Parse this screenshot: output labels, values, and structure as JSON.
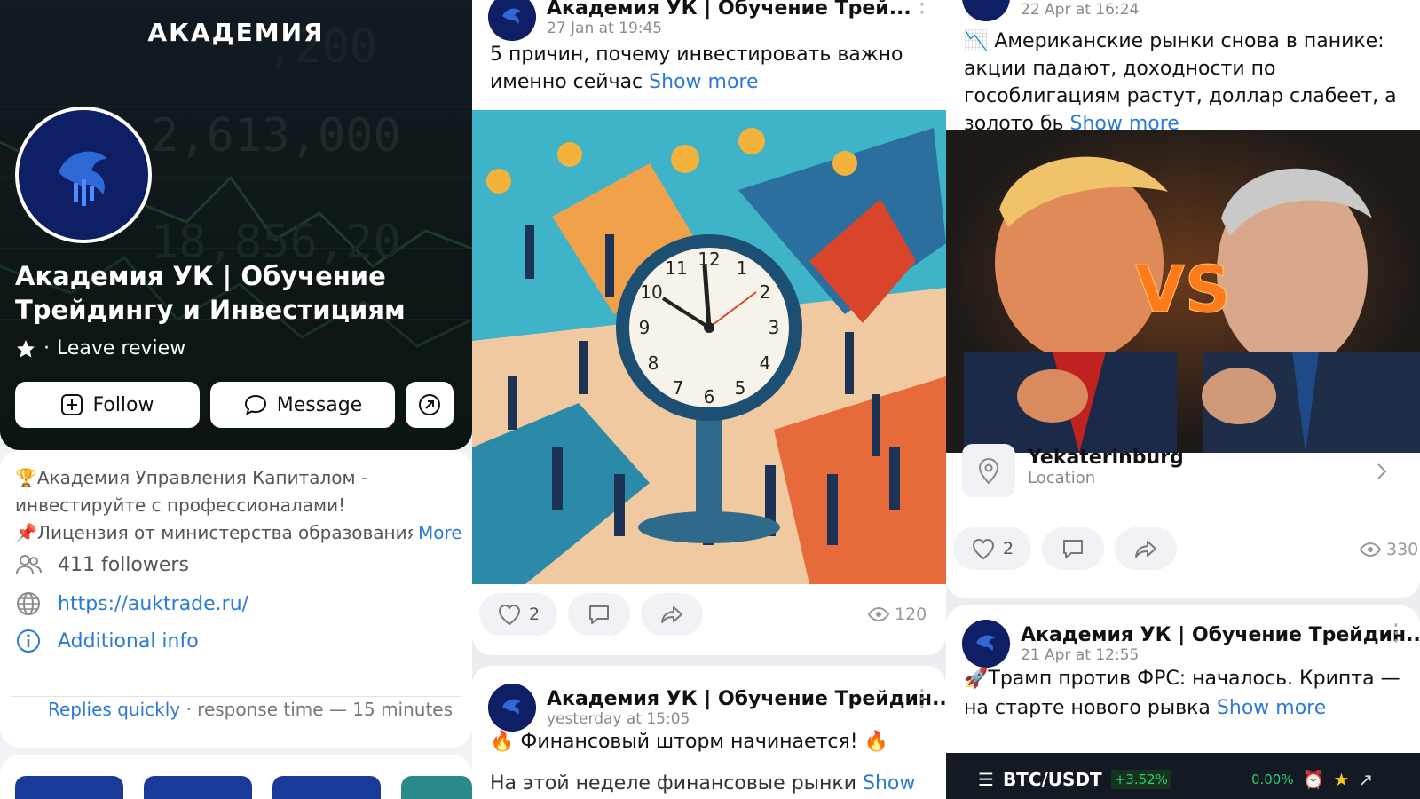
{
  "channel": {
    "brand": "АКАДЕМИЯ",
    "title": "Академия УК | Обучение Трейдингу и Инвестициям",
    "leave_review": "Leave review",
    "follow": "Follow",
    "message": "Message",
    "description": "🏆Академия Управления Капиталом - инвестируйте с профессионалами!\n📌Лицензия от министерства образования",
    "more": "More",
    "followers": "411 followers",
    "url": "https://auktrade.ru/",
    "additional": "Additional info",
    "replies_quickly": "Replies quickly",
    "response_time": " · response time — 15 minutes"
  },
  "posts": [
    {
      "name": "Академия УК | Обучение Трей...",
      "date": "27 Jan at 19:45",
      "text": "5 причин, почему инвестировать важно именно сейчас",
      "show_more": "Show more",
      "likes": "2",
      "views": "120"
    },
    {
      "name": "Академия УК | Обучение Трейдин...",
      "date": "yesterday at 15:05",
      "text": "🔥 Финансовый шторм начинается! 🔥",
      "text2": "На этой неделе финансовые рынки",
      "show_more": "Show more"
    },
    {
      "date": "22 Apr at 16:24",
      "text": "📉 Американские рынки снова в панике: акции падают, доходности по гособлигациям растут, доллар слабеет, а золото бь",
      "show_more": "Show more",
      "location_city": "Yekaterinburg",
      "location_label": "Location",
      "likes": "2",
      "views": "330",
      "vs": "VS"
    },
    {
      "name": "Академия УК | Обучение Трейдин...",
      "date": "21 Apr at 12:55",
      "text": "🚀Трамп против ФРС: началось. Крипта — на старте нового рывка",
      "show_more": "Show more"
    }
  ],
  "ticker": {
    "pair": "BTC/USDT",
    "change": "+3.52%",
    "mm": "0.00%"
  },
  "colors": {
    "link": "#2a7bd8",
    "dark": "#0b0f15",
    "green": "#2ecc71"
  },
  "icons": [
    "star-icon",
    "plus-square-icon",
    "chat-icon",
    "share-circle-icon",
    "followers-icon",
    "globe-icon",
    "info-icon",
    "heart-icon",
    "comment-icon",
    "share-icon",
    "eye-icon",
    "pin-icon",
    "chevron-right-icon",
    "kebab-icon",
    "star-gold-icon",
    "external-link-icon"
  ]
}
